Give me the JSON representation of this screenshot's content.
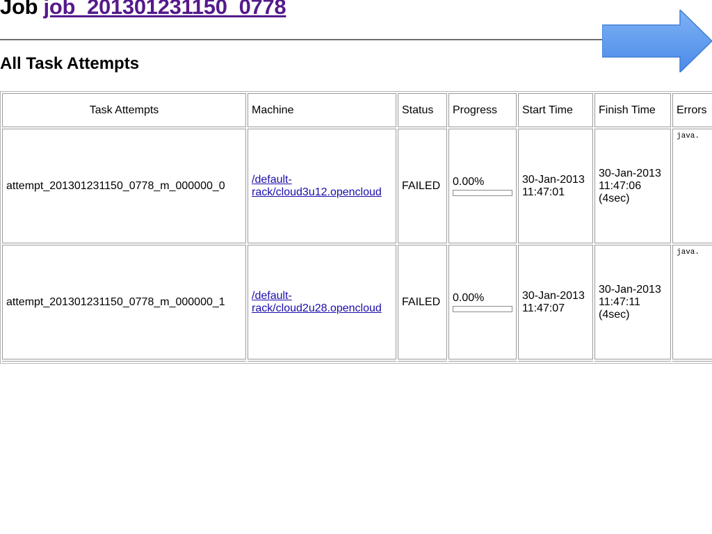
{
  "header": {
    "job_prefix": "Job",
    "job_id": "job_201301231150_0778"
  },
  "section_title": "All Task Attempts",
  "table": {
    "columns": [
      "Task Attempts",
      "Machine",
      "Status",
      "Progress",
      "Start Time",
      "Finish Time",
      "Errors"
    ],
    "rows": [
      {
        "attempt": "attempt_201301231150_0778_m_000000_0",
        "machine_line1": "/default-",
        "machine_line2": "rack/cloud3u12.opencloud",
        "status": "FAILED",
        "progress": "0.00%",
        "progress_fraction": 0.0,
        "start_date": "30-Jan-2013",
        "start_time": "11:47:01",
        "finish_date": "30-Jan-2013",
        "finish_time": "11:47:06",
        "finish_duration": "(4sec)",
        "error": "java."
      },
      {
        "attempt": "attempt_201301231150_0778_m_000000_1",
        "machine_line1": "/default-",
        "machine_line2": "rack/cloud2u28.opencloud",
        "status": "FAILED",
        "progress": "0.00%",
        "progress_fraction": 0.0,
        "start_date": "30-Jan-2013",
        "start_time": "11:47:07",
        "finish_date": "30-Jan-2013",
        "finish_time": "11:47:11",
        "finish_duration": "(4sec)",
        "error": "java."
      }
    ]
  },
  "icons": {
    "next": "arrow-right-icon"
  },
  "colors": {
    "link_visited": "#551a8b",
    "link": "#1a0dab",
    "arrow_fill": "#5b9bf0",
    "arrow_stroke": "#3f7fd6"
  }
}
